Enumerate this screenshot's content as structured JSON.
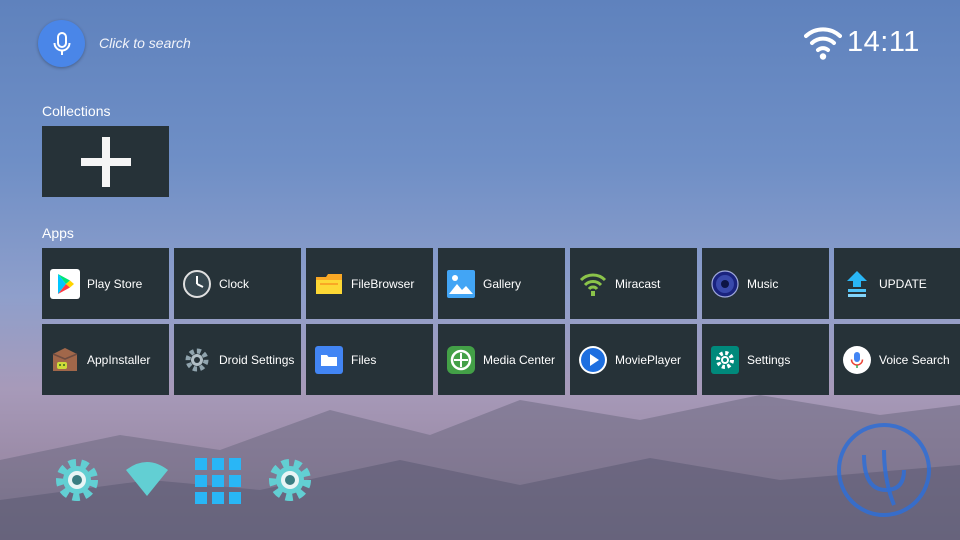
{
  "search": {
    "hint": "Click to search",
    "icon": "microphone-icon"
  },
  "status": {
    "time": "14:11",
    "wifi_icon": "wifi-icon"
  },
  "collections": {
    "title": "Collections",
    "add_icon": "plus-icon"
  },
  "apps": {
    "title": "Apps",
    "items": [
      {
        "label": "Play Store",
        "icon": "play-store-icon"
      },
      {
        "label": "Clock",
        "icon": "clock-icon"
      },
      {
        "label": "FileBrowser",
        "icon": "folder-icon"
      },
      {
        "label": "Gallery",
        "icon": "gallery-icon"
      },
      {
        "label": "Miracast",
        "icon": "miracast-icon"
      },
      {
        "label": "Music",
        "icon": "music-icon"
      },
      {
        "label": "UPDATE",
        "icon": "update-icon"
      },
      {
        "label": "AppInstaller",
        "icon": "app-installer-icon"
      },
      {
        "label": "Droid Settings",
        "icon": "droid-settings-icon"
      },
      {
        "label": "Files",
        "icon": "files-icon"
      },
      {
        "label": "Media Center",
        "icon": "media-center-icon"
      },
      {
        "label": "MoviePlayer",
        "icon": "movie-player-icon"
      },
      {
        "label": "Settings",
        "icon": "settings-icon"
      },
      {
        "label": "Voice Search",
        "icon": "voice-search-icon"
      }
    ]
  },
  "dock": [
    "settings-gear-icon",
    "wifi-icon",
    "all-apps-grid-icon",
    "settings-gear-icon"
  ],
  "colors": {
    "tile": "#263238",
    "accent": "#4a86e8",
    "dock": "#62cfd3"
  }
}
